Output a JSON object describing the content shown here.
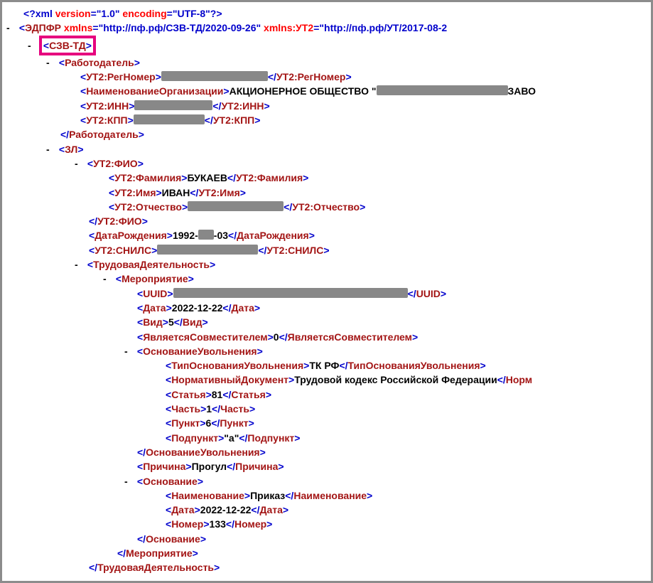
{
  "lbr": "<",
  "rbr": ">",
  "lbrs": "</",
  "q": "?",
  "eq": "=",
  "quo": "\"",
  "dash": "-",
  "redact": "████████",
  "pi": {
    "xml": "xml",
    "version_attr": "version",
    "version_val": "1.0",
    "enc_attr": "encoding",
    "enc_val": "UTF-8"
  },
  "root": {
    "name": "ЭДПФР",
    "xmlns_attr": "xmlns",
    "xmlns_val": "http://пф.рф/СЗВ-ТД/2020-09-26",
    "ns2_attr": "xmlns:УТ2",
    "ns2_val": "http://пф.рф/УТ/2017-08-2"
  },
  "szvtd": {
    "name": "СЗВ-ТД"
  },
  "employer": {
    "open": "Работодатель",
    "regnum": "УТ2:РегНомер",
    "orgname_tag": "НаименованиеОрганизации",
    "orgname_val_prefix": "АКЦИОНЕРНОЕ ОБЩЕСТВО \"",
    "orgname_val_suffix": "ЗАВО",
    "inn": "УТ2:ИНН",
    "kpp": "УТ2:КПП"
  },
  "zl": {
    "open": "ЗЛ",
    "fio": "УТ2:ФИО",
    "fam_tag": "УТ2:Фамилия",
    "fam_val": "БУКАЕВ",
    "im_tag": "УТ2:Имя",
    "im_val": "ИВАН",
    "ot_tag": "УТ2:Отчество",
    "dob_tag": "ДатаРождения",
    "dob_pre": "1992-",
    "dob_post": "-03",
    "snils_tag": "УТ2:СНИЛС"
  },
  "work": {
    "td": "ТрудоваяДеятельность",
    "event": "Мероприятие",
    "uuid_tag": "UUID",
    "date_tag": "Дата",
    "date_val": "2022-12-22",
    "vid_tag": "Вид",
    "vid_val": "5",
    "sov_tag": "ЯвляетсяСовместителем",
    "sov_val": "0",
    "osnuv": "ОснованиеУвольнения",
    "tip_tag": "ТипОснованияУвольнения",
    "tip_val": "ТК РФ",
    "norm_tag": "НормативныйДокумент",
    "norm_val": "Трудовой кодекс Российской Федерации",
    "norm_close": "Норм",
    "st_tag": "Статья",
    "st_val": "81",
    "ch_tag": "Часть",
    "ch_val": "1",
    "pu_tag": "Пункт",
    "pu_val": "6",
    "pp_tag": "Подпункт",
    "pp_val": "\"а\"",
    "reason_tag": "Причина",
    "reason_val": "Прогул",
    "osn": "Основание",
    "naim_tag": "Наименование",
    "naim_val": "Приказ",
    "odate_tag": "Дата",
    "odate_val": "2022-12-22",
    "num_tag": "Номер",
    "num_val": "133"
  }
}
